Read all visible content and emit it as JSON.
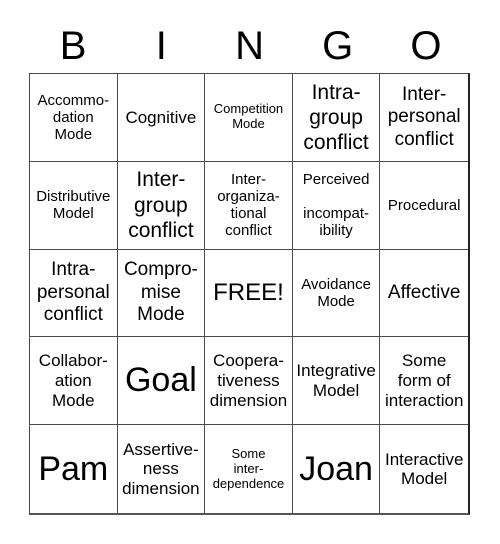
{
  "header": {
    "letters": [
      "B",
      "I",
      "N",
      "G",
      "O"
    ]
  },
  "cells": [
    {
      "text": "Accommo-\ndation\nMode",
      "size": "s-sm"
    },
    {
      "text": "Cognitive",
      "size": "s-md"
    },
    {
      "text": "Competition\nMode",
      "size": "s-xs"
    },
    {
      "text": "Intra-\ngroup\nconflict",
      "size": "s-xl"
    },
    {
      "text": "Inter-\npersonal\nconflict",
      "size": "s-lg"
    },
    {
      "text": "Distributive\nModel",
      "size": "s-sm"
    },
    {
      "text": "Inter-\ngroup\nconflict",
      "size": "s-xl"
    },
    {
      "text": "Inter-\norganiza-\ntional\nconflict",
      "size": "s-sm"
    },
    {
      "text": "Perceived\n\nincompat-\nibility",
      "size": "s-sm"
    },
    {
      "text": "Procedural",
      "size": "s-sm"
    },
    {
      "text": "Intra-\npersonal\nconflict",
      "size": "s-lg"
    },
    {
      "text": "Compro-\nmise\nMode",
      "size": "s-lg"
    },
    {
      "text": "FREE!",
      "size": "s-free"
    },
    {
      "text": "Avoidance\nMode",
      "size": "s-sm"
    },
    {
      "text": "Affective",
      "size": "s-lg"
    },
    {
      "text": "Collabor-\nation\nMode",
      "size": "s-md"
    },
    {
      "text": "Goal",
      "size": "s-xxl"
    },
    {
      "text": "Coopera-\ntiveness\ndimension",
      "size": "s-md"
    },
    {
      "text": "Integrative\nModel",
      "size": "s-md"
    },
    {
      "text": "Some\nform of\ninteraction",
      "size": "s-md"
    },
    {
      "text": "Pam",
      "size": "s-xxl"
    },
    {
      "text": "Assertive-\nness\ndimension",
      "size": "s-md"
    },
    {
      "text": "Some\ninter-\ndependence",
      "size": "s-xs"
    },
    {
      "text": "Joan",
      "size": "s-xxl"
    },
    {
      "text": "Interactive\nModel",
      "size": "s-md"
    }
  ]
}
